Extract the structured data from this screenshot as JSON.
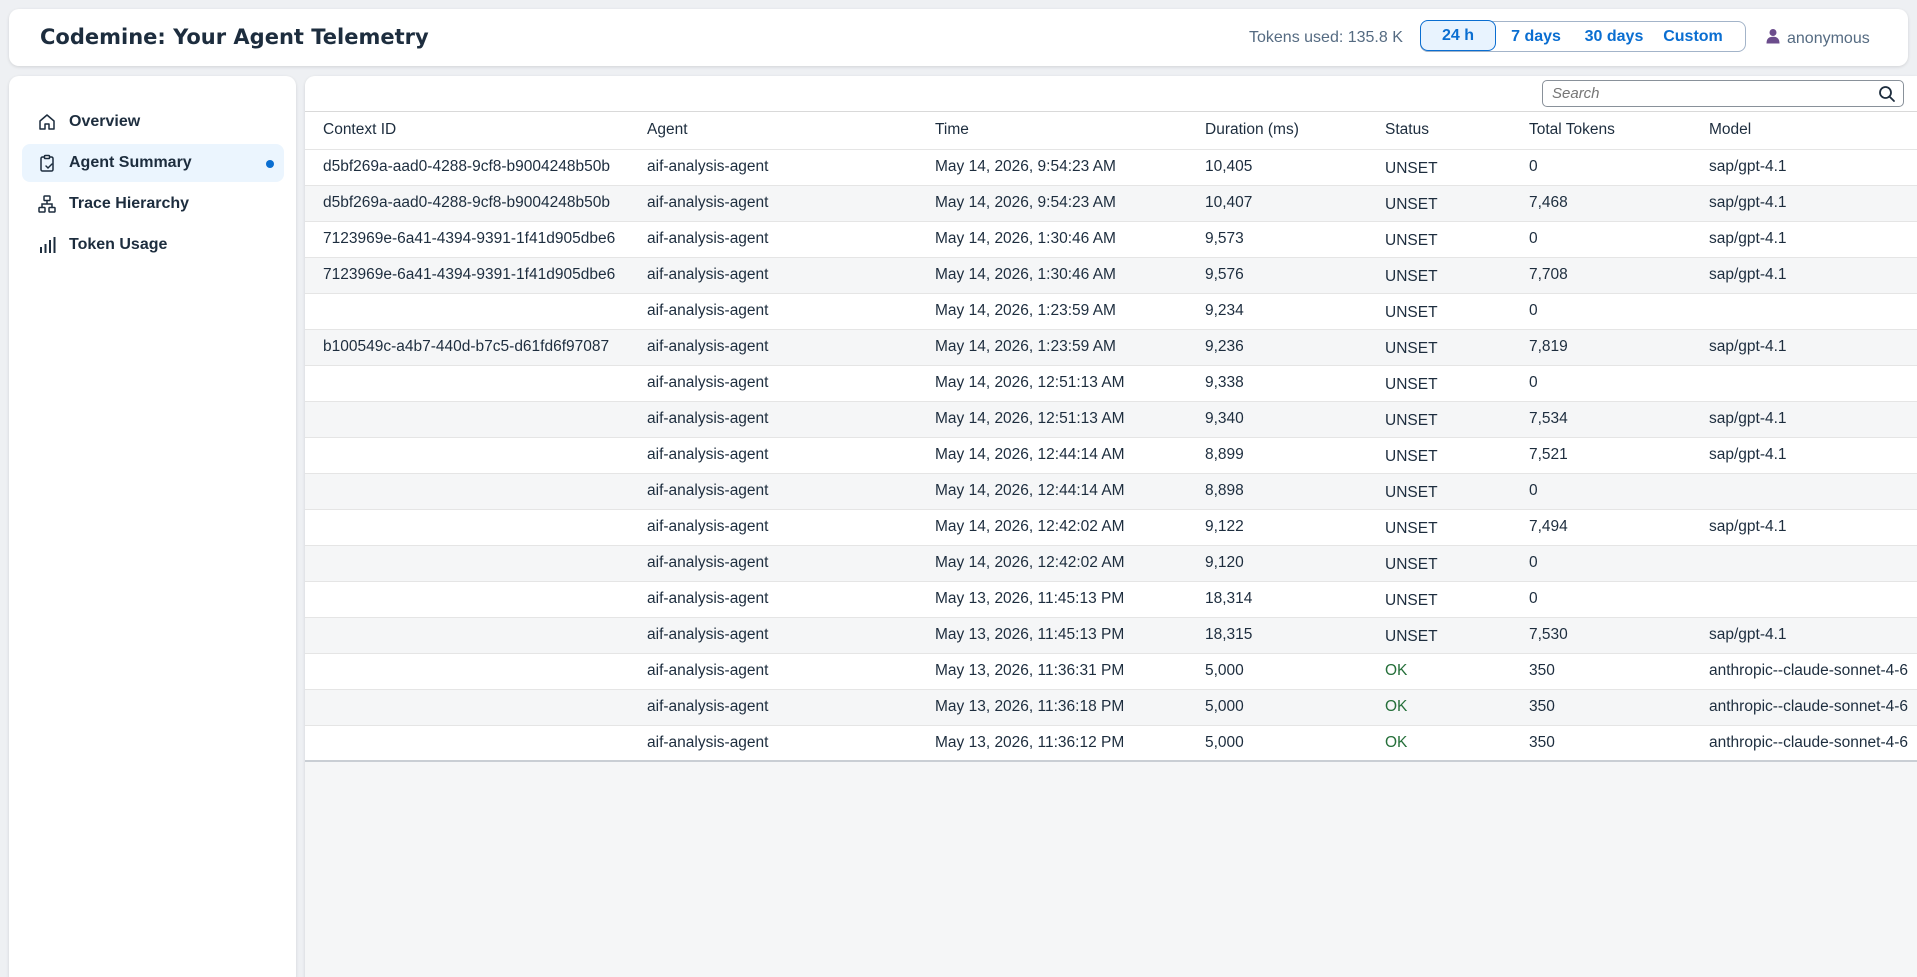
{
  "header": {
    "title": "Codemine: Your Agent Telemetry",
    "tokens_used": "Tokens used: 135.8 K",
    "ranges": [
      "24 h",
      "7 days",
      "30 days",
      "Custom"
    ],
    "active_range": "24 h",
    "user": "anonymous",
    "accent_color": "#0a6ed1"
  },
  "sidebar": {
    "items": [
      {
        "label": "Overview",
        "icon": "home-icon"
      },
      {
        "label": "Agent Summary",
        "icon": "clipboard-check-icon",
        "selected": true
      },
      {
        "label": "Trace Hierarchy",
        "icon": "hierarchy-icon"
      },
      {
        "label": "Token Usage",
        "icon": "bar-chart-icon"
      }
    ]
  },
  "search": {
    "placeholder": "Search"
  },
  "table": {
    "columns": [
      "Context ID",
      "Agent",
      "Time",
      "Duration (ms)",
      "Status",
      "Total Tokens",
      "Model"
    ],
    "rows": [
      [
        "d5bf269a-aad0-4288-9cf8-b9004248b50b",
        "aif-analysis-agent",
        "May 14, 2026, 9:54:23 AM",
        "10,405",
        "UNSET",
        "0",
        "sap/gpt-4.1"
      ],
      [
        "d5bf269a-aad0-4288-9cf8-b9004248b50b",
        "aif-analysis-agent",
        "May 14, 2026, 9:54:23 AM",
        "10,407",
        "UNSET",
        "7,468",
        "sap/gpt-4.1"
      ],
      [
        "7123969e-6a41-4394-9391-1f41d905dbe6",
        "aif-analysis-agent",
        "May 14, 2026, 1:30:46 AM",
        "9,573",
        "UNSET",
        "0",
        "sap/gpt-4.1"
      ],
      [
        "7123969e-6a41-4394-9391-1f41d905dbe6",
        "aif-analysis-agent",
        "May 14, 2026, 1:30:46 AM",
        "9,576",
        "UNSET",
        "7,708",
        "sap/gpt-4.1"
      ],
      [
        "",
        "aif-analysis-agent",
        "May 14, 2026, 1:23:59 AM",
        "9,234",
        "UNSET",
        "0",
        ""
      ],
      [
        "b100549c-a4b7-440d-b7c5-d61fd6f97087",
        "aif-analysis-agent",
        "May 14, 2026, 1:23:59 AM",
        "9,236",
        "UNSET",
        "7,819",
        "sap/gpt-4.1"
      ],
      [
        "",
        "aif-analysis-agent",
        "May 14, 2026, 12:51:13 AM",
        "9,338",
        "UNSET",
        "0",
        ""
      ],
      [
        "",
        "aif-analysis-agent",
        "May 14, 2026, 12:51:13 AM",
        "9,340",
        "UNSET",
        "7,534",
        "sap/gpt-4.1"
      ],
      [
        "",
        "aif-analysis-agent",
        "May 14, 2026, 12:44:14 AM",
        "8,899",
        "UNSET",
        "7,521",
        "sap/gpt-4.1"
      ],
      [
        "",
        "aif-analysis-agent",
        "May 14, 2026, 12:44:14 AM",
        "8,898",
        "UNSET",
        "0",
        ""
      ],
      [
        "",
        "aif-analysis-agent",
        "May 14, 2026, 12:42:02 AM",
        "9,122",
        "UNSET",
        "7,494",
        "sap/gpt-4.1"
      ],
      [
        "",
        "aif-analysis-agent",
        "May 14, 2026, 12:42:02 AM",
        "9,120",
        "UNSET",
        "0",
        ""
      ],
      [
        "",
        "aif-analysis-agent",
        "May 13, 2026, 11:45:13 PM",
        "18,314",
        "UNSET",
        "0",
        ""
      ],
      [
        "",
        "aif-analysis-agent",
        "May 13, 2026, 11:45:13 PM",
        "18,315",
        "UNSET",
        "7,530",
        "sap/gpt-4.1"
      ],
      [
        "",
        "aif-analysis-agent",
        "May 13, 2026, 11:36:31 PM",
        "5,000",
        "OK",
        "350",
        "anthropic--claude-sonnet-4-6"
      ],
      [
        "",
        "aif-analysis-agent",
        "May 13, 2026, 11:36:18 PM",
        "5,000",
        "OK",
        "350",
        "anthropic--claude-sonnet-4-6"
      ],
      [
        "",
        "aif-analysis-agent",
        "May 13, 2026, 11:36:12 PM",
        "5,000",
        "OK",
        "350",
        "anthropic--claude-sonnet-4-6"
      ]
    ],
    "status_colors": {
      "OK": "#256f3a",
      "UNSET": "#1d2d3e"
    }
  }
}
